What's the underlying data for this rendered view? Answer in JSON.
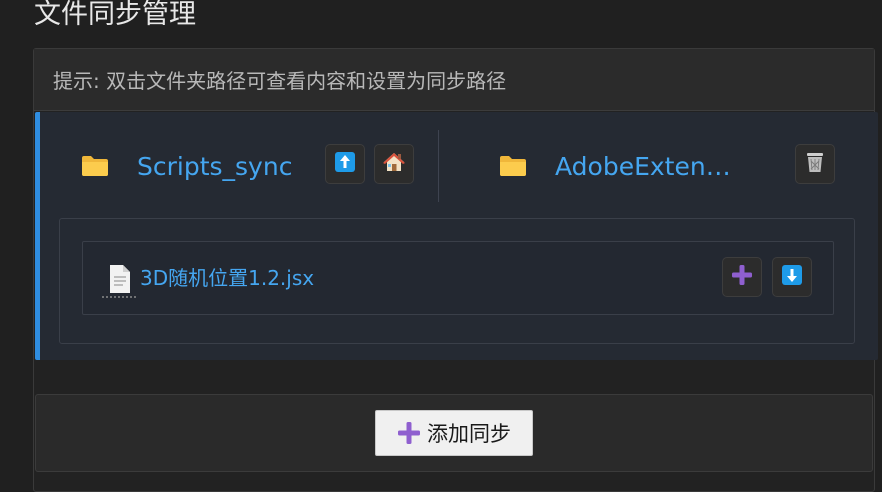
{
  "page": {
    "title": "文件同步管理"
  },
  "hint": {
    "text": "提示: 双击文件夹路径可查看内容和设置为同步路径"
  },
  "sync_pair": {
    "source_folder": "Scripts_sync",
    "target_folder": "AdobeExten…",
    "source_buttons": [
      "upload-icon",
      "home-icon"
    ],
    "target_buttons": [
      "trash-icon"
    ],
    "accent_color": "#2f8de0"
  },
  "files": [
    {
      "name": "3D随机位置1.2.jsx",
      "actions": [
        "add-icon",
        "download-icon"
      ]
    }
  ],
  "add_sync": {
    "label": "添加同步"
  }
}
